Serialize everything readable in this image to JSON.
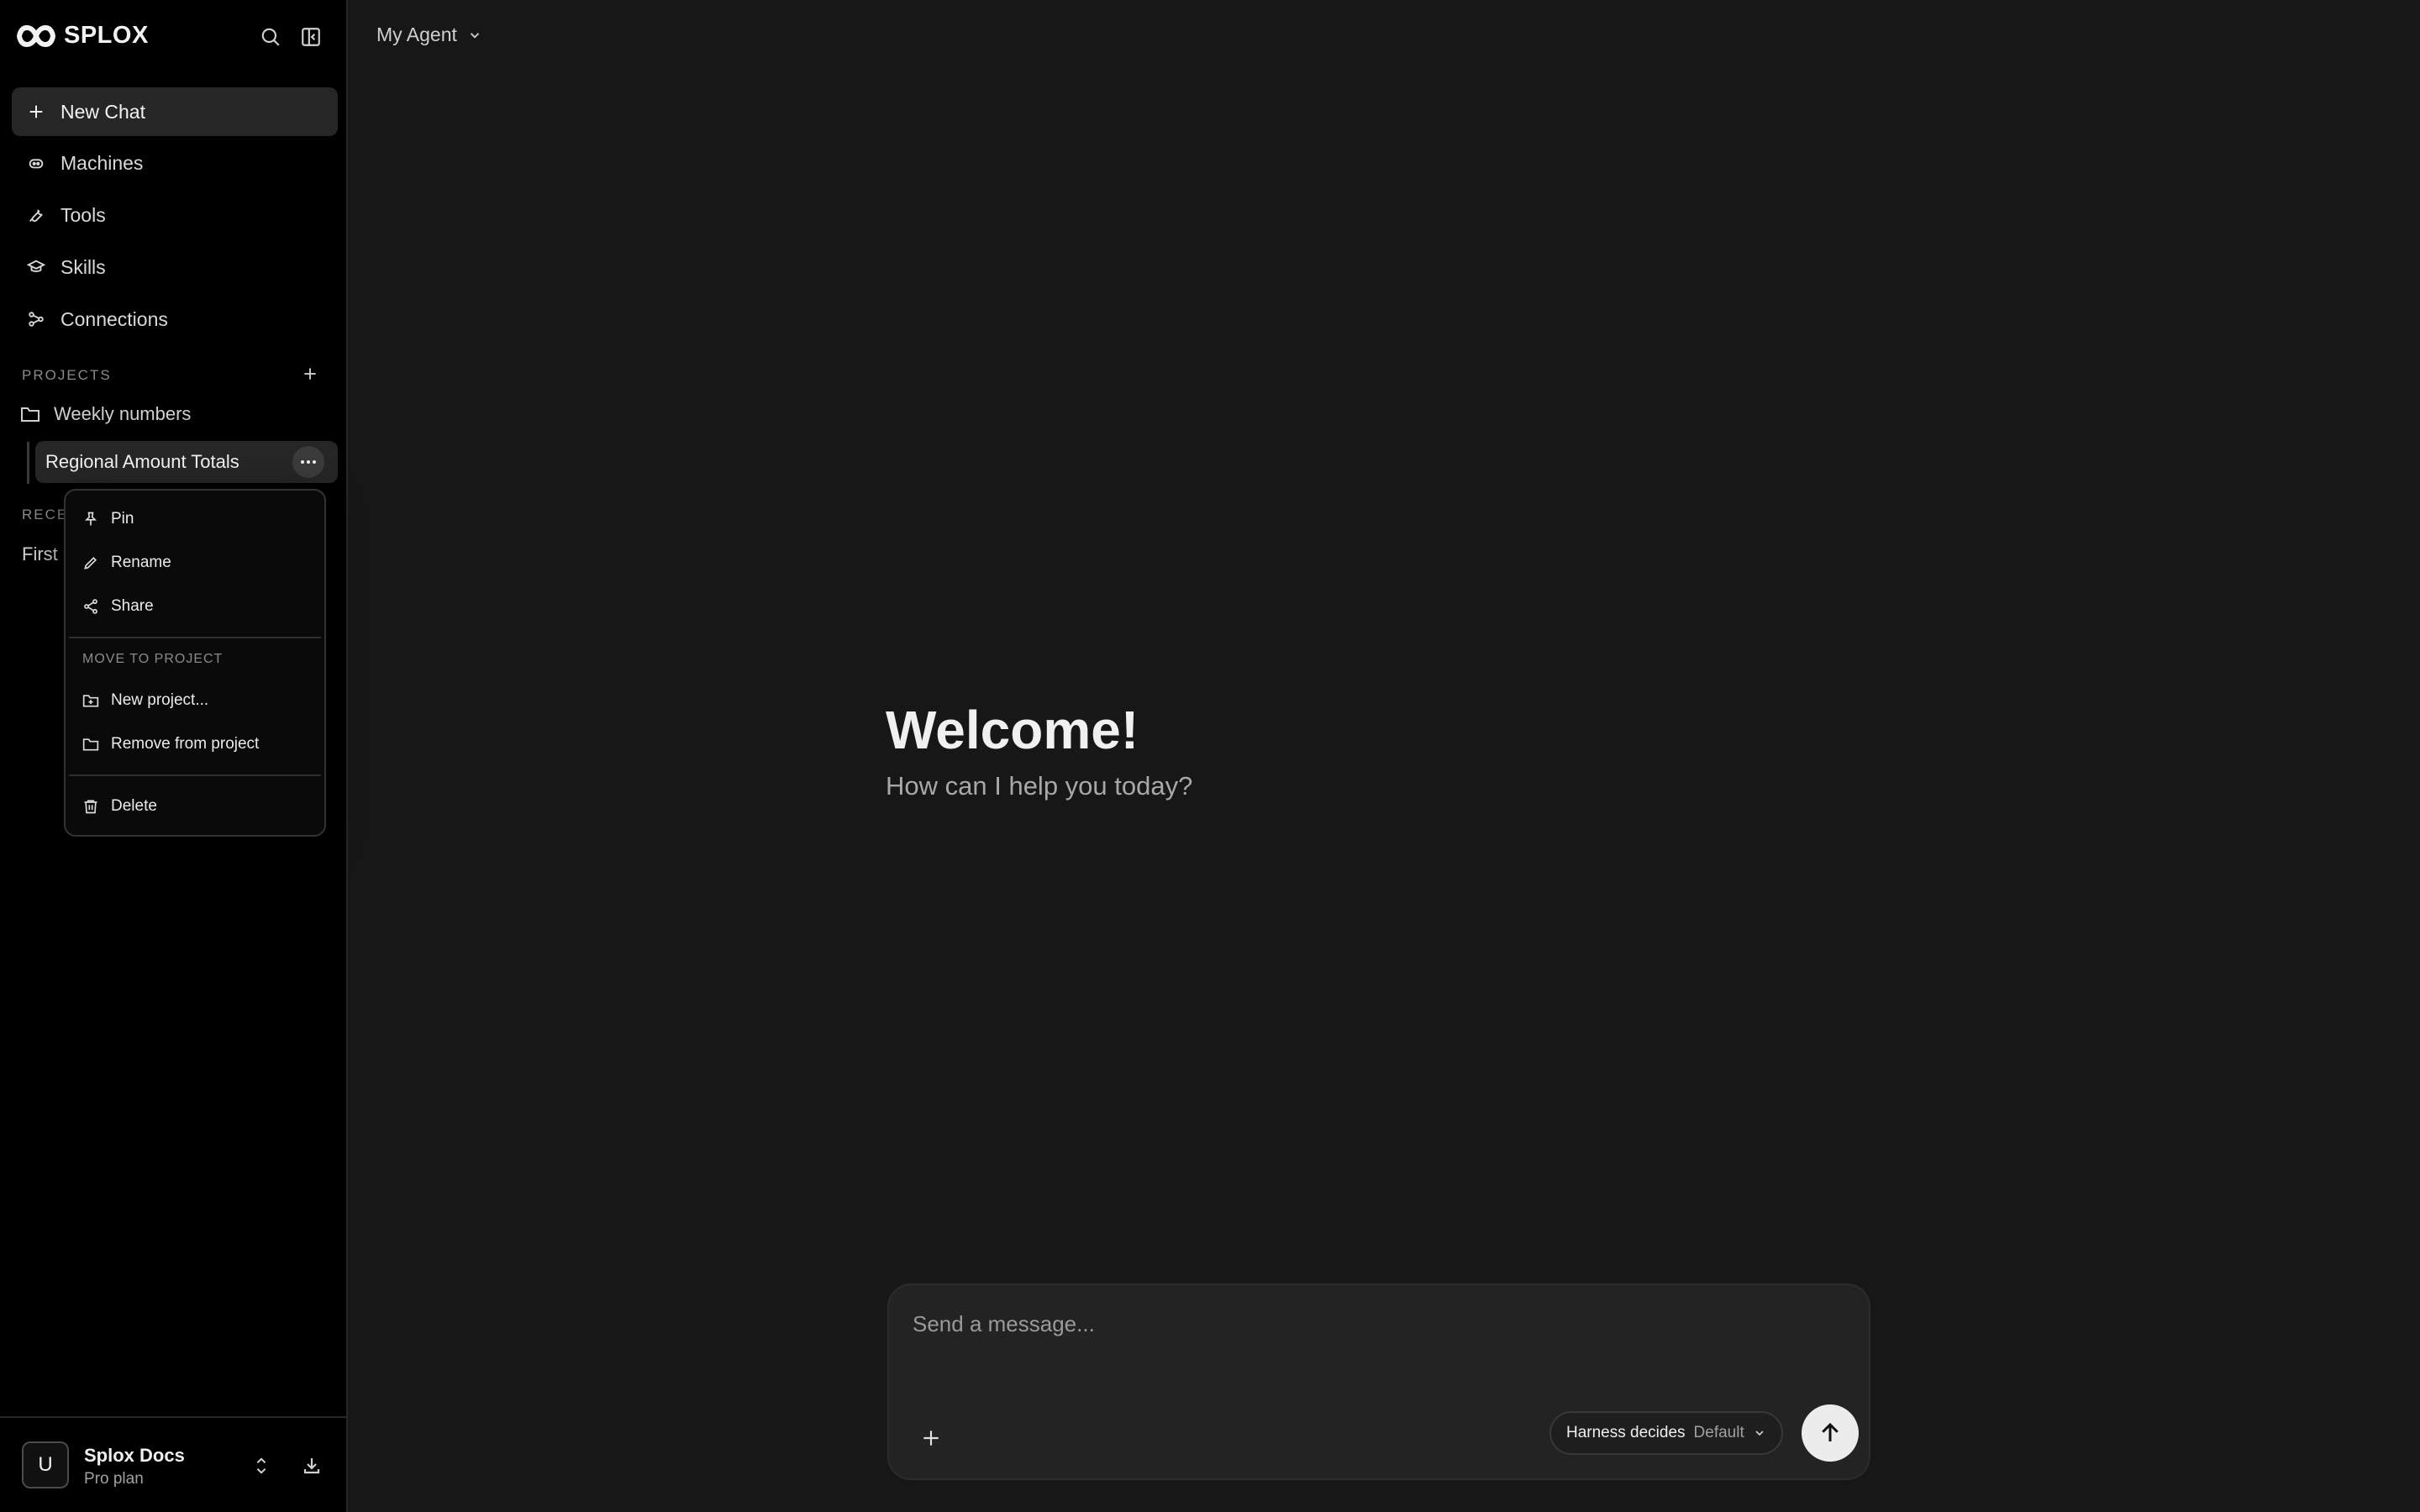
{
  "app": {
    "name": "SPLOX"
  },
  "sidebar": {
    "new_chat": "New Chat",
    "nav": [
      {
        "label": "Machines",
        "icon": "robot-icon"
      },
      {
        "label": "Tools",
        "icon": "wrench-icon"
      },
      {
        "label": "Skills",
        "icon": "graduation-cap-icon"
      },
      {
        "label": "Connections",
        "icon": "connections-icon"
      }
    ],
    "projects_label": "PROJECTS",
    "project": {
      "name": "Weekly numbers"
    },
    "active_chat": "Regional Amount Totals",
    "recents_label": "RECE",
    "recent_peek": "First"
  },
  "context_menu": {
    "pin": "Pin",
    "rename": "Rename",
    "share": "Share",
    "move_label": "MOVE TO PROJECT",
    "new_project": "New project...",
    "remove_from_project": "Remove from project",
    "delete": "Delete"
  },
  "user": {
    "initial": "U",
    "name": "Splox Docs",
    "plan": "Pro plan"
  },
  "header": {
    "agent": "My Agent"
  },
  "main": {
    "welcome_title": "Welcome!",
    "welcome_subtitle": "How can I help you today?"
  },
  "composer": {
    "placeholder": "Send a message...",
    "model_main": "Harness decides",
    "model_sub": "Default"
  },
  "colors": {
    "sidebar_bg": "#000000",
    "main_bg": "#171717",
    "active_item": "#262626",
    "send_button": "#ececec"
  }
}
